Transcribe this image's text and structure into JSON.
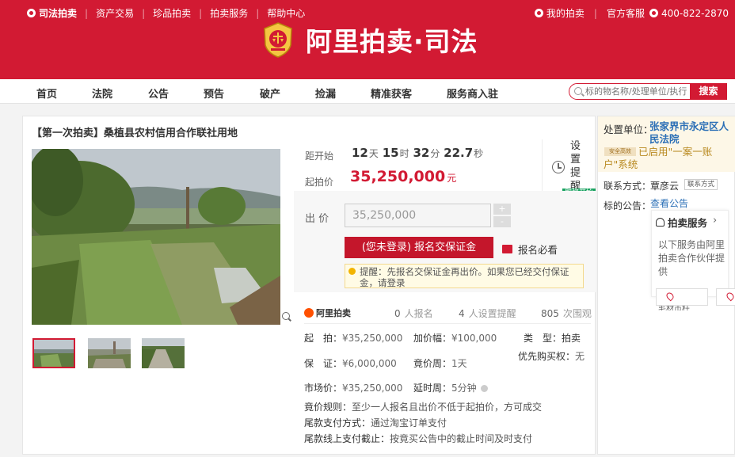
{
  "topnav": {
    "brand": "司法拍卖",
    "links": [
      "资产交易",
      "珍品拍卖",
      "拍卖服务",
      "帮助中心"
    ],
    "my_auction": "我的拍卖",
    "service": "官方客服",
    "phone": "400-822-2870"
  },
  "logo": {
    "text": "阿里拍卖·司法"
  },
  "mainnav": {
    "items": [
      "首页",
      "法院",
      "公告",
      "预告",
      "破产",
      "捡漏",
      "精准获客",
      "服务商入驻"
    ],
    "search_placeholder": "标的物名称/处理单位/执行",
    "search_button": "搜索"
  },
  "product": {
    "title": "【第一次拍卖】桑植县农村信用合作联社用地",
    "countdown_label": "距开始",
    "countdown": {
      "days": "12",
      "days_unit": "天",
      "hours": "15",
      "hours_unit": "时",
      "minutes": "32",
      "minutes_unit": "分",
      "seconds": "22.7",
      "seconds_unit": "秒"
    },
    "start_price_label": "起拍价",
    "start_price": "35,250,000",
    "price_unit": "元",
    "remind_label": "设置提醒",
    "remind_tag": "即将开始",
    "bid_label": "出 价",
    "bid_value": "35,250,000",
    "stepper_plus": "+",
    "stepper_minus": "-",
    "cta": "(您未登录) 报名交保证金",
    "must_read": "报名必看",
    "tip": "提醒：先报名交保证金再出价。如果您已经交付保证金，请登录"
  },
  "stats": {
    "logo": "阿里拍卖",
    "signups": "0",
    "signups_label": "人报名",
    "reminders": "4",
    "reminders_label": "人设置提醒",
    "views": "805",
    "views_label": "次围观"
  },
  "details": {
    "start_price": {
      "k": "起　拍：",
      "v": "¥35,250,000"
    },
    "increment": {
      "k": "加价幅：",
      "v": "¥100,000"
    },
    "type": {
      "k": "类　型：",
      "v": "拍卖"
    },
    "deposit": {
      "k": "保　证：",
      "v": "¥6,000,000"
    },
    "bid_period": {
      "k": "竟价周：",
      "v": "1天"
    },
    "priority": {
      "k": "优先购买权：",
      "v": "无"
    },
    "market_price": {
      "k": "市场价：",
      "v": "¥35,250,000"
    },
    "delay_period": {
      "k": "延时周：",
      "v": "5分钟"
    },
    "rules": [
      {
        "k": "竟价规则：",
        "v": "至少一人报名且出价不低于起拍价，方可成交"
      },
      {
        "k": "尾款支付方式：",
        "v": "通过淘宝订单支付"
      },
      {
        "k": "尾款线上支付截止：",
        "v": "按竟买公告中的截止时间及时支付"
      }
    ]
  },
  "side": {
    "unit_label": "处置单位：",
    "unit": "张家界市永定区人民法院",
    "safe_badge": "安全高效",
    "activated": "已启用\"一案一账户\"系统",
    "contact_label": "联系方式：",
    "contact_name": "覃彦云",
    "contact_button": "联系方式",
    "notice_label": "标的公告：",
    "notice_link": "查看公告",
    "service_title": "拍卖服务",
    "service_arrow": "›",
    "service_desc": "以下服务由阿里拍卖合作伙伴提供",
    "cut_text": "毛材币枉"
  },
  "colors": {
    "brand_red": "#d21a33",
    "price_red": "#d21a33",
    "link_blue": "#2b6fb6",
    "green_tag": "#1aa260"
  }
}
